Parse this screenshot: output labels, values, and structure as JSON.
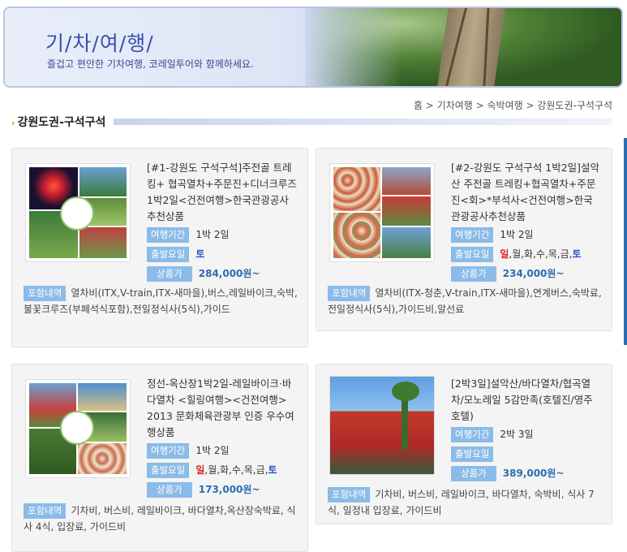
{
  "banner": {
    "title": "기/차/여/행/",
    "subtitle": "즐겁고 편안한 기차여행, 코레일투어와 함께하세요."
  },
  "breadcrumb": "홈 > 기차여행 > 숙박여행 > 강원도권-구석구석",
  "section_title": "강원도권-구석구석",
  "labels": {
    "duration": "여행기간",
    "departure": "출발요일",
    "price": "상품가",
    "includes": "포함내역"
  },
  "products": [
    {
      "title": "[#1-강원도 구석구석]주전골 트레킹+ 협곡열차+주문진+디너크루즈 1박2일<건전여행>한국관광공사추천상품",
      "duration": "1박 2일",
      "departure": "토",
      "price": "284,000원~",
      "includes": "열차비(ITX,V-train,ITX-새마을),버스,레일바이크,숙박,불꽃크루즈(부페석식포함),전일정식사(5식),가이드"
    },
    {
      "title": "[#2-강원도 구석구석 1박2일]설악산 주전골 트레킹+협곡열차+주문진<회>*부석사<건전여행>한국관광공사추천상품",
      "duration": "1박 2일",
      "departure_red": "일",
      "departure_rest": ",월,화,수,목,금,",
      "departure_last": "토",
      "price": "234,000원~",
      "includes": "열차비(ITX-청춘,V-train,ITX-새마을),연계버스,숙박료,전일정식사(5식),가이드비,알선료"
    },
    {
      "title": "정선-옥산장1박2일-레일바이크·바다열차 <힐링여행><건전여행> 2013 문화체육관광부 인증 우수여행상품",
      "duration": "1박 2일",
      "departure_red": "일",
      "departure_rest": ",월,화,수,목,금,",
      "departure_last": "토",
      "price": "173,000원~",
      "includes": "기차비, 버스비, 레일바이크, 바다열차,옥산장숙박료, 식사 4식, 입장료, 가이드비"
    },
    {
      "title": "[2박3일]설악산/바다열차/협곡열차/모노레일 5감만족(호텔진/영주호텔)",
      "duration": "2박 3일",
      "departure": "",
      "price": "389,000원~",
      "includes": "기차비, 버스비, 레일바이크, 바다열차, 숙박비, 식사 7식, 일정내 입장료, 가이드비"
    }
  ]
}
